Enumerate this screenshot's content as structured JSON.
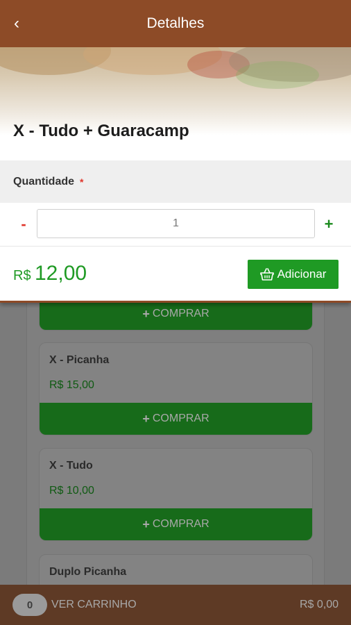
{
  "header": {
    "title": "Detalhes",
    "back_icon": "‹"
  },
  "product": {
    "title": "X - Tudo + Guaracamp",
    "quantity_label": "Quantidade",
    "required_mark": "*",
    "quantity_value": "1",
    "minus_label": "-",
    "plus_label": "+",
    "price_currency": "R$",
    "price_value": "12,00",
    "add_label": "Adicionar"
  },
  "background_list": {
    "buy_plus": "+",
    "buy_label": "COMPRAR",
    "items": [
      {
        "name": "X - Picanha",
        "price": "R$ 15,00"
      },
      {
        "name": "X - Tudo",
        "price": "R$ 10,00"
      },
      {
        "name": "Duplo Picanha",
        "price": ""
      }
    ]
  },
  "cart": {
    "count": "0",
    "label": "VER CARRINHO",
    "total": "R$ 0,00"
  },
  "colors": {
    "header": "#8d4b27",
    "accent_green": "#1f9a24",
    "required_red": "#e0352b",
    "cart_bar": "#5e3a25"
  }
}
